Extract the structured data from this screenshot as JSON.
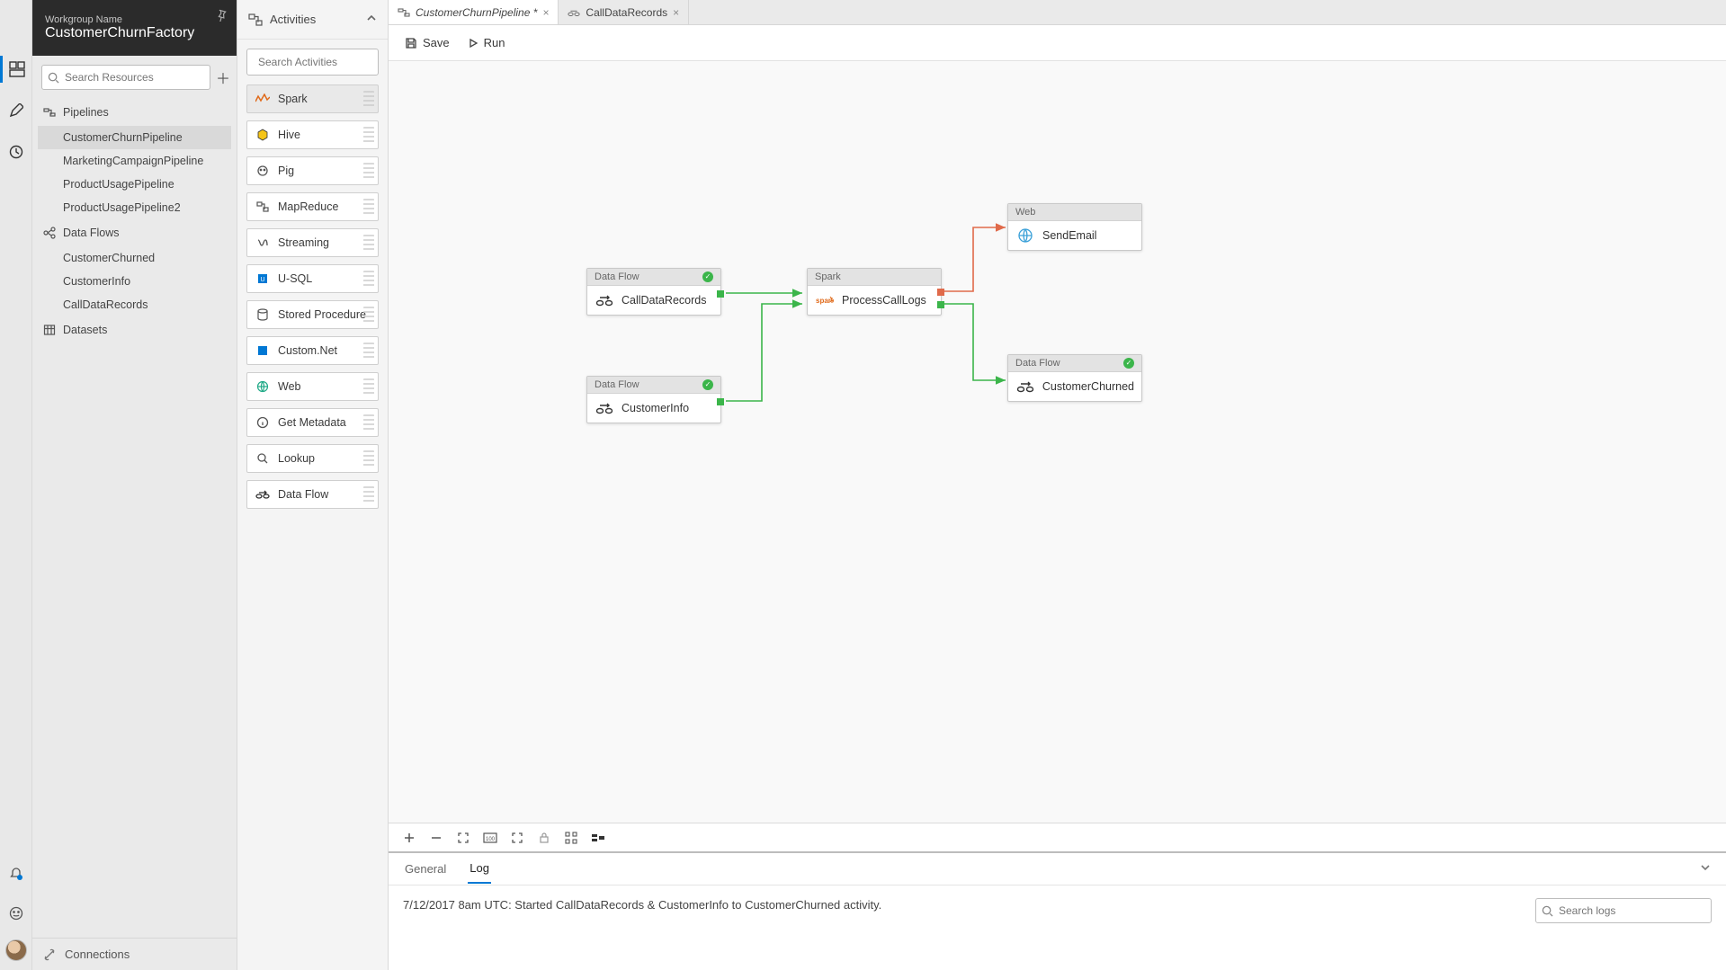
{
  "header": {
    "workgroup_label": "Workgroup Name",
    "factory_name": "CustomerChurnFactory"
  },
  "sidebar": {
    "search_placeholder": "Search Resources",
    "groups": [
      {
        "label": "Pipelines",
        "items": [
          "CustomerChurnPipeline",
          "MarketingCampaignPipeline",
          "ProductUsagePipeline",
          "ProductUsagePipeline2"
        ]
      },
      {
        "label": "Data Flows",
        "items": [
          "CustomerChurned",
          "CustomerInfo",
          "CallDataRecords"
        ]
      },
      {
        "label": "Datasets",
        "items": []
      }
    ],
    "connections_label": "Connections"
  },
  "activities": {
    "title": "Activities",
    "search_placeholder": "Search Activities",
    "items": [
      "Spark",
      "Hive",
      "Pig",
      "MapReduce",
      "Streaming",
      "U-SQL",
      "Stored Procedure",
      "Custom.Net",
      "Web",
      "Get Metadata",
      "Lookup",
      "Data Flow"
    ]
  },
  "tabs": [
    {
      "label": "CustomerChurnPipeline *",
      "active": true
    },
    {
      "label": "CallDataRecords",
      "active": false
    }
  ],
  "toolbar": {
    "save": "Save",
    "run": "Run"
  },
  "nodes": {
    "n1": {
      "type": "Data Flow",
      "title": "CallDataRecords",
      "status": "ok"
    },
    "n2": {
      "type": "Data Flow",
      "title": "CustomerInfo",
      "status": "ok"
    },
    "n3": {
      "type": "Spark",
      "title": "ProcessCallLogs",
      "status": ""
    },
    "n4": {
      "type": "Web",
      "title": "SendEmail",
      "status": ""
    },
    "n5": {
      "type": "Data Flow",
      "title": "CustomerChurned",
      "status": "ok"
    }
  },
  "bottom": {
    "tabs": [
      "General",
      "Log"
    ],
    "active_tab": "Log",
    "log_entry": "7/12/2017 8am UTC: Started CallDataRecords & CustomerInfo to CustomerChurned activity.",
    "search_placeholder": "Search logs"
  }
}
